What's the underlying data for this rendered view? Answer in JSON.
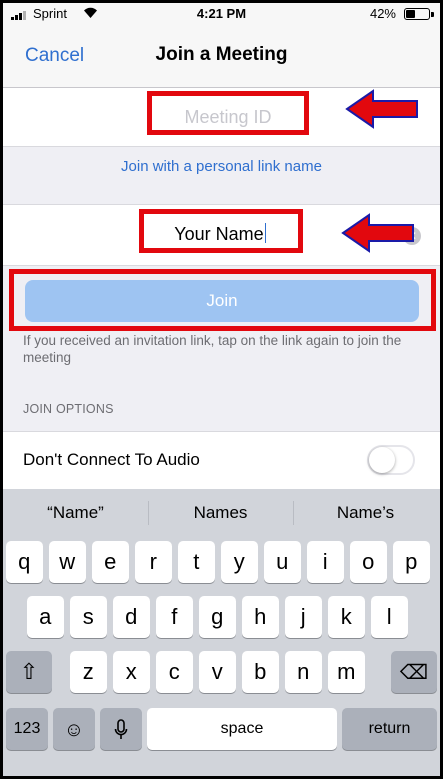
{
  "status_bar": {
    "carrier": "Sprint",
    "time": "4:21 PM",
    "battery_percent": "42%",
    "battery_level": 0.42
  },
  "nav": {
    "cancel_label": "Cancel",
    "title": "Join a Meeting"
  },
  "form": {
    "meeting_id_placeholder": "Meeting ID",
    "meeting_id_value": "",
    "personal_link_label": "Join with a personal link name",
    "name_value": "Your Name",
    "join_label": "Join",
    "help_text": "If you received an invitation link, tap on the link again to join the meeting"
  },
  "join_options": {
    "header": "JOIN OPTIONS",
    "dont_connect_audio_label": "Don't Connect To Audio",
    "dont_connect_audio_on": false
  },
  "keyboard": {
    "predictions": [
      "“Name”",
      "Names",
      "Name’s"
    ],
    "row1": [
      "q",
      "w",
      "e",
      "r",
      "t",
      "y",
      "u",
      "i",
      "o",
      "p"
    ],
    "row2": [
      "a",
      "s",
      "d",
      "f",
      "g",
      "h",
      "j",
      "k",
      "l"
    ],
    "row3": [
      "z",
      "x",
      "c",
      "v",
      "b",
      "n",
      "m"
    ],
    "numbers_label": "123",
    "space_label": "space",
    "return_label": "return"
  },
  "colors": {
    "accent": "#2f6fcf",
    "join_button": "#9ec4f2",
    "annotation_red": "#e2080e"
  },
  "icons": {
    "signal": "signal-bars-icon",
    "wifi": "wifi-icon",
    "battery": "battery-icon",
    "clear": "clear-text-icon",
    "shift": "shift-icon",
    "backspace": "backspace-icon",
    "emoji": "emoji-icon",
    "mic": "microphone-icon",
    "annotation_arrow": "red-arrow-icon"
  }
}
